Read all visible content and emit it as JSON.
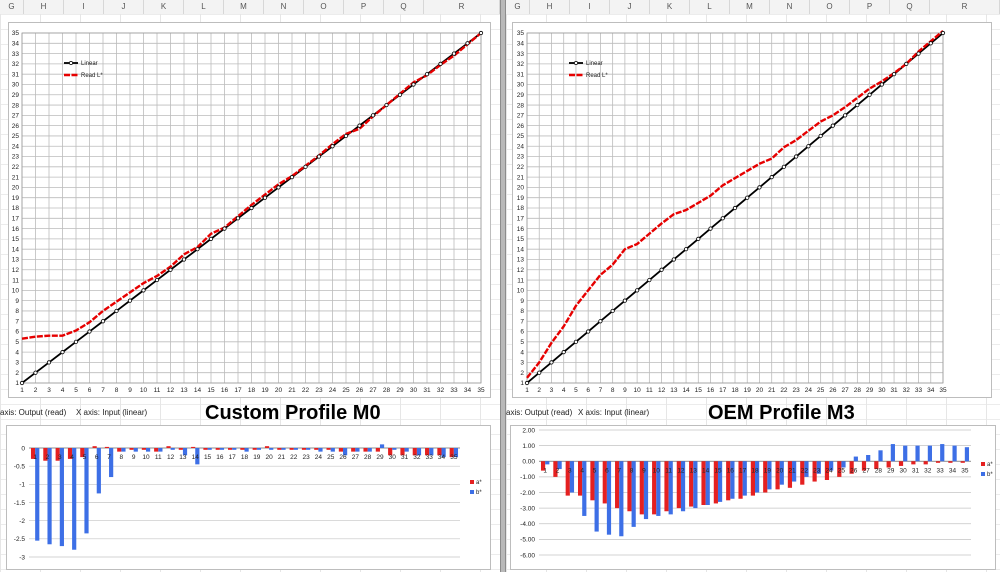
{
  "colors": {
    "linear": "#000000",
    "read_l": "#e60000",
    "a_star": "#e52020",
    "b_star": "#3d6fe6"
  },
  "left": {
    "columns": [
      "G",
      "H",
      "I",
      "J",
      "K",
      "L",
      "M",
      "N",
      "O",
      "P",
      "Q",
      "R"
    ],
    "axis_note_1": "axis: Output (read)",
    "axis_note_2": "X axis: Input (linear)",
    "title": "Custom Profile M0"
  },
  "right": {
    "columns": [
      "G",
      "H",
      "I",
      "J",
      "K",
      "L",
      "M",
      "N",
      "O",
      "P",
      "Q",
      "R"
    ],
    "axis_note_1": "axis: Output (read)",
    "axis_note_2": "X axis: Input (linear)",
    "title": "OEM Profile M3"
  },
  "chart_data": [
    {
      "id": "m0-line",
      "type": "line",
      "x": [
        1,
        2,
        3,
        4,
        5,
        6,
        7,
        8,
        9,
        10,
        11,
        12,
        13,
        14,
        15,
        16,
        17,
        18,
        19,
        20,
        21,
        22,
        23,
        24,
        25,
        26,
        27,
        28,
        29,
        30,
        31,
        32,
        33,
        34,
        35
      ],
      "xlim": [
        1,
        35
      ],
      "ylim": [
        1,
        35
      ],
      "grid": true,
      "legend": "top-left",
      "series": [
        {
          "name": "Linear",
          "values": [
            1,
            2,
            3,
            4,
            5,
            6,
            7,
            8,
            9,
            10,
            11,
            12,
            13,
            14,
            15,
            16,
            17,
            18,
            19,
            20,
            21,
            22,
            23,
            24,
            25,
            26,
            27,
            28,
            29,
            30,
            31,
            32,
            33,
            34,
            35
          ]
        },
        {
          "name": "Read L*",
          "values": [
            5.3,
            5.5,
            5.6,
            5.6,
            6.1,
            6.9,
            8.0,
            8.9,
            9.8,
            10.7,
            11.4,
            12.3,
            13.5,
            14.2,
            15.5,
            16.1,
            17.2,
            18.3,
            19.3,
            20.3,
            21.1,
            22.1,
            23.1,
            24.2,
            25.2,
            25.7,
            26.9,
            28.0,
            29.1,
            30.2,
            30.9,
            31.9,
            32.8,
            33.9,
            35.0
          ]
        }
      ]
    },
    {
      "id": "m3-line",
      "type": "line",
      "x": [
        1,
        2,
        3,
        4,
        5,
        6,
        7,
        8,
        9,
        10,
        11,
        12,
        13,
        14,
        15,
        16,
        17,
        18,
        19,
        20,
        21,
        22,
        23,
        24,
        25,
        26,
        27,
        28,
        29,
        30,
        31,
        32,
        33,
        34,
        35
      ],
      "xlim": [
        1,
        35
      ],
      "ylim": [
        1,
        35
      ],
      "grid": true,
      "legend": "top-left",
      "series": [
        {
          "name": "Linear",
          "values": [
            1,
            2,
            3,
            4,
            5,
            6,
            7,
            8,
            9,
            10,
            11,
            12,
            13,
            14,
            15,
            16,
            17,
            18,
            19,
            20,
            21,
            22,
            23,
            24,
            25,
            26,
            27,
            28,
            29,
            30,
            31,
            32,
            33,
            34,
            35
          ]
        },
        {
          "name": "Read L*",
          "values": [
            1.5,
            3.0,
            4.9,
            6.5,
            8.5,
            10.0,
            11.5,
            12.5,
            14.0,
            14.5,
            15.5,
            16.5,
            17.4,
            17.8,
            18.5,
            19.2,
            20.2,
            20.9,
            21.6,
            22.3,
            22.8,
            23.9,
            24.6,
            25.5,
            26.4,
            27.0,
            27.8,
            28.7,
            29.6,
            30.3,
            31.1,
            32.0,
            33.2,
            34.2,
            35.2
          ]
        }
      ]
    },
    {
      "id": "m0-bars",
      "type": "bar",
      "categories": [
        "1",
        "2",
        "3",
        "4",
        "5",
        "6",
        "7",
        "8",
        "9",
        "10",
        "11",
        "12",
        "13",
        "14",
        "15",
        "16",
        "17",
        "18",
        "19",
        "20",
        "21",
        "22",
        "23",
        "24",
        "25",
        "26",
        "27",
        "28",
        "29",
        "30",
        "31",
        "32",
        "33",
        "34",
        "35"
      ],
      "ylim": [
        -3,
        0
      ],
      "yticks": [
        "0",
        "-0.5",
        "-1",
        "-1.5",
        "-2",
        "-2.5",
        "-3"
      ],
      "legend": "right",
      "series": [
        {
          "name": "a*",
          "values": [
            -0.3,
            -0.35,
            -0.35,
            -0.3,
            -0.25,
            0.05,
            0.03,
            -0.1,
            -0.05,
            -0.05,
            -0.1,
            0.05,
            -0.05,
            0.03,
            -0.05,
            -0.05,
            -0.05,
            -0.05,
            -0.05,
            0.05,
            -0.05,
            -0.05,
            -0.05,
            -0.05,
            -0.05,
            -0.1,
            -0.1,
            -0.1,
            -0.1,
            -0.2,
            -0.2,
            -0.2,
            -0.2,
            -0.2,
            -0.25
          ]
        },
        {
          "name": "b*",
          "values": [
            -2.55,
            -2.65,
            -2.7,
            -2.8,
            -2.35,
            -1.25,
            -0.8,
            -0.1,
            -0.1,
            -0.1,
            -0.1,
            -0.05,
            -0.2,
            -0.45,
            -0.05,
            -0.05,
            -0.05,
            -0.1,
            -0.05,
            -0.05,
            -0.05,
            -0.05,
            -0.05,
            -0.1,
            -0.1,
            -0.2,
            -0.1,
            -0.1,
            0.1,
            -0.05,
            -0.1,
            -0.2,
            -0.2,
            -0.25,
            -0.25
          ]
        }
      ]
    },
    {
      "id": "m3-bars",
      "type": "bar",
      "categories": [
        "1",
        "2",
        "3",
        "4",
        "5",
        "6",
        "7",
        "8",
        "9",
        "10",
        "11",
        "12",
        "13",
        "14",
        "15",
        "16",
        "17",
        "18",
        "19",
        "20",
        "21",
        "22",
        "23",
        "24",
        "25",
        "26",
        "27",
        "28",
        "29",
        "30",
        "31",
        "32",
        "33",
        "34",
        "35"
      ],
      "ylim": [
        -6,
        2
      ],
      "yticks": [
        "2.00",
        "1.00",
        "0.00",
        "-1.00",
        "-2.00",
        "-3.00",
        "-4.00",
        "-5.00",
        "-6.00"
      ],
      "legend": "right",
      "series": [
        {
          "name": "a*",
          "values": [
            -0.6,
            -1.0,
            -2.2,
            -2.2,
            -2.5,
            -2.7,
            -3.0,
            -3.2,
            -3.4,
            -3.4,
            -3.2,
            -3.0,
            -2.9,
            -2.8,
            -2.7,
            -2.5,
            -2.4,
            -2.2,
            -2.0,
            -1.8,
            -1.7,
            -1.5,
            -1.3,
            -1.2,
            -1.0,
            -0.8,
            -0.6,
            -0.5,
            -0.4,
            -0.3,
            -0.2,
            -0.2,
            -0.1,
            -0.1,
            -0.1
          ]
        },
        {
          "name": "b*",
          "values": [
            -0.2,
            -0.5,
            -2.0,
            -3.5,
            -4.5,
            -4.7,
            -4.8,
            -4.2,
            -3.7,
            -3.5,
            -3.4,
            -3.2,
            -3.0,
            -2.8,
            -2.6,
            -2.4,
            -2.2,
            -2.0,
            -1.8,
            -1.5,
            -1.3,
            -1.0,
            -0.8,
            -0.6,
            -0.4,
            0.3,
            0.4,
            0.7,
            1.1,
            1.0,
            1.0,
            1.0,
            1.1,
            1.0,
            0.9
          ]
        }
      ]
    }
  ]
}
